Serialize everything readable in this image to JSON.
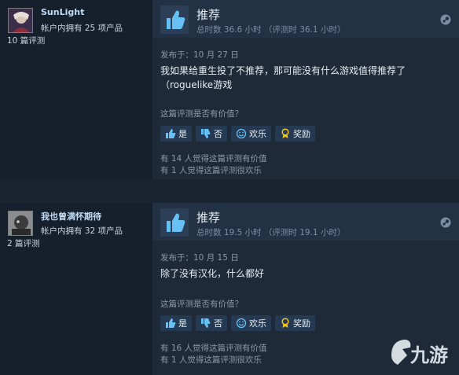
{
  "reviews": [
    {
      "author": "SunLight",
      "products_owned": "帐户内拥有 25 项产品",
      "review_count": "10 篇评测",
      "recommendation": "推荐",
      "hours": "总时数 36.6 小时 （评测时 36.1 小时）",
      "posted": "发布于：10 月 27 日",
      "text": "我如果给重生投了不推荐，那可能没有什么游戏值得推荐了（roguelike游戏",
      "helpful_question": "这篇评测是否有价值？",
      "buttons": {
        "yes": "是",
        "no": "否",
        "funny": "欢乐",
        "award": "奖励"
      },
      "helpful_stat": "有 14 人觉得这篇评测有价值",
      "funny_stat": "有 1 人觉得这篇评测很欢乐"
    },
    {
      "author": "我也曾满怀期待",
      "products_owned": "帐户内拥有 32 项产品",
      "review_count": "2 篇评测",
      "recommendation": "推荐",
      "hours": "总时数 19.5 小时 （评测时 19.1 小时）",
      "posted": "发布于：10 月 15 日",
      "text": "除了没有汉化，什么都好",
      "helpful_question": "这篇评测是否有价值？",
      "buttons": {
        "yes": "是",
        "no": "否",
        "funny": "欢乐",
        "award": "奖励"
      },
      "helpful_stat": "有 16 人觉得这篇评测有价值",
      "funny_stat": "有 1 人觉得这篇评测很欢乐"
    }
  ],
  "watermark": "九游",
  "colors": {
    "accent": "#66c0f4",
    "background": "#1b2838",
    "author": "#c1dbf4"
  },
  "icons": [
    "thumbs-up-icon",
    "thumbs-down-icon",
    "smiley-icon",
    "award-icon",
    "steam-icon"
  ]
}
